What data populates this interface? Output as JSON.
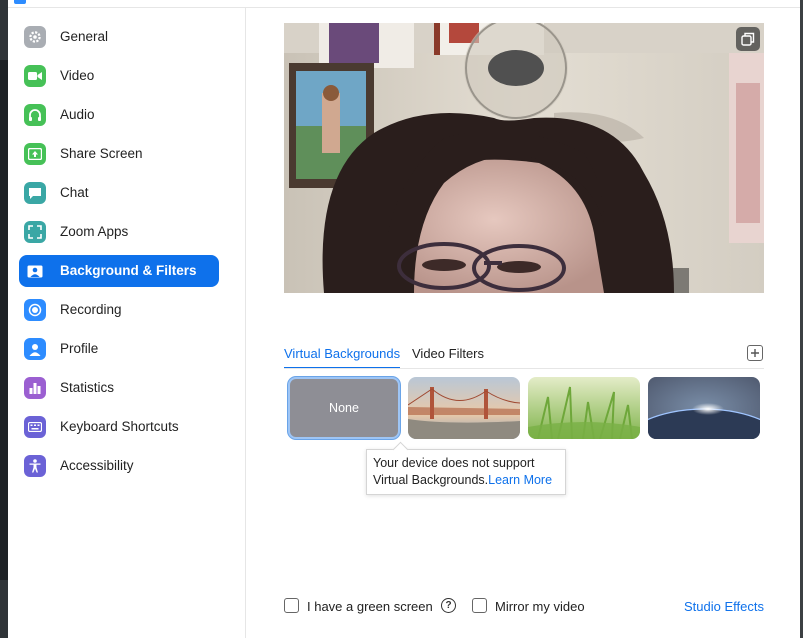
{
  "sidebar": {
    "items": [
      {
        "label": "General",
        "icon": "gear-icon",
        "color": "#a9adb3"
      },
      {
        "label": "Video",
        "icon": "video-camera-icon",
        "color": "#46c157"
      },
      {
        "label": "Audio",
        "icon": "headphones-icon",
        "color": "#46c157"
      },
      {
        "label": "Share Screen",
        "icon": "share-screen-icon",
        "color": "#46c157"
      },
      {
        "label": "Chat",
        "icon": "chat-bubble-icon",
        "color": "#3aa7a5"
      },
      {
        "label": "Zoom Apps",
        "icon": "zoom-apps-icon",
        "color": "#3aa7a5"
      },
      {
        "label": "Background & Filters",
        "icon": "background-person-icon",
        "color": "#ffffff",
        "active": true
      },
      {
        "label": "Recording",
        "icon": "record-icon",
        "color": "#2d8cff"
      },
      {
        "label": "Profile",
        "icon": "profile-person-icon",
        "color": "#2d8cff"
      },
      {
        "label": "Statistics",
        "icon": "bar-chart-icon",
        "color": "#9b5fd1"
      },
      {
        "label": "Keyboard Shortcuts",
        "icon": "keyboard-icon",
        "color": "#6b62d6"
      },
      {
        "label": "Accessibility",
        "icon": "accessibility-icon",
        "color": "#6b62d6"
      }
    ]
  },
  "tabs": {
    "virtual_backgrounds": "Virtual Backgrounds",
    "video_filters": "Video Filters",
    "active": "Virtual Backgrounds"
  },
  "backgrounds": {
    "none_label": "None",
    "items": [
      "None",
      "golden-gate-bridge",
      "grass",
      "earth-from-space"
    ]
  },
  "tooltip": {
    "line1": "Your device does not support",
    "line2": "Virtual Backgrounds.",
    "link": "Learn More"
  },
  "footer": {
    "green_screen_label": "I have a green screen",
    "green_screen_checked": false,
    "mirror_label": "Mirror my video",
    "mirror_checked": false,
    "studio_effects": "Studio Effects"
  },
  "colors": {
    "accent": "#0e71eb",
    "link": "#0e71eb"
  }
}
